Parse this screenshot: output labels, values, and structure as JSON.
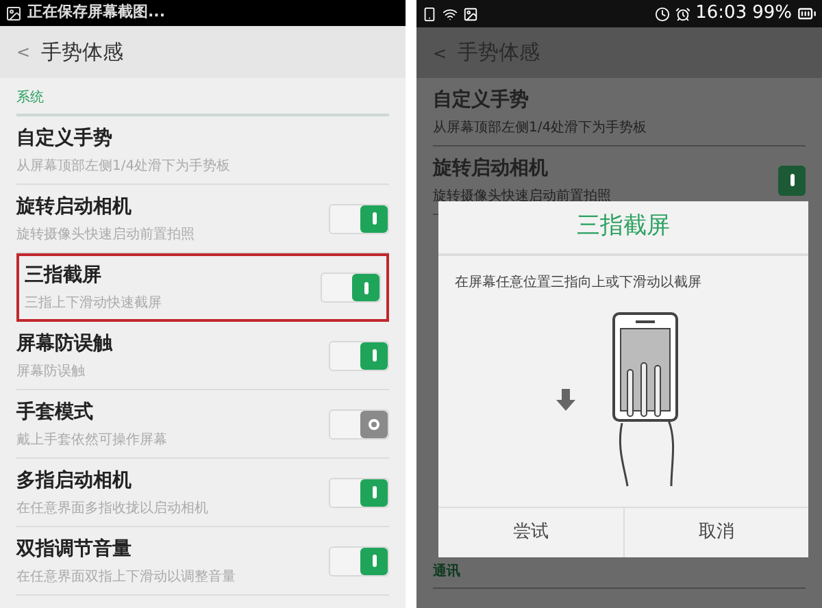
{
  "left_screen": {
    "status_bar": {
      "text": "正在保存屏幕截图..."
    },
    "header": {
      "back": "<",
      "title": "手势体感"
    },
    "section": "系统",
    "items": [
      {
        "title": "自定义手势",
        "subtitle": "从屏幕顶部左侧1/4处滑下为手势板",
        "kind": "link",
        "highlighted": false
      },
      {
        "title": "旋转启动相机",
        "subtitle": "旋转摄像头快速启动前置拍照",
        "kind": "toggle",
        "on": true,
        "highlighted": false
      },
      {
        "title": "三指截屏",
        "subtitle": "三指上下滑动快速截屏",
        "kind": "toggle",
        "on": true,
        "highlighted": true
      },
      {
        "title": "屏幕防误触",
        "subtitle": "屏幕防误触",
        "kind": "toggle",
        "on": true,
        "highlighted": false
      },
      {
        "title": "手套模式",
        "subtitle": "戴上手套依然可操作屏幕",
        "kind": "toggle",
        "on": false,
        "highlighted": false
      },
      {
        "title": "多指启动相机",
        "subtitle": "在任意界面多指收拢以启动相机",
        "kind": "toggle",
        "on": true,
        "highlighted": false
      },
      {
        "title": "双指调节音量",
        "subtitle": "在任意界面双指上下滑动以调整音量",
        "kind": "toggle",
        "on": true,
        "highlighted": false
      }
    ]
  },
  "right_screen": {
    "status_bar": {
      "time": "16:03",
      "battery": "99%"
    },
    "header": {
      "back": "<",
      "title": "手势体感"
    },
    "items": [
      {
        "title": "自定义手势",
        "subtitle": "从屏幕顶部左侧1/4处滑下为手势板",
        "kind": "link"
      },
      {
        "title": "旋转启动相机",
        "subtitle": "旋转摄像头快速启动前置拍照",
        "kind": "toggle",
        "on": true
      }
    ],
    "section": "通讯",
    "dialog": {
      "title": "三指截屏",
      "message": "在屏幕任意位置三指向上或下滑动以截屏",
      "buttons": [
        "尝试",
        "取消"
      ]
    }
  }
}
